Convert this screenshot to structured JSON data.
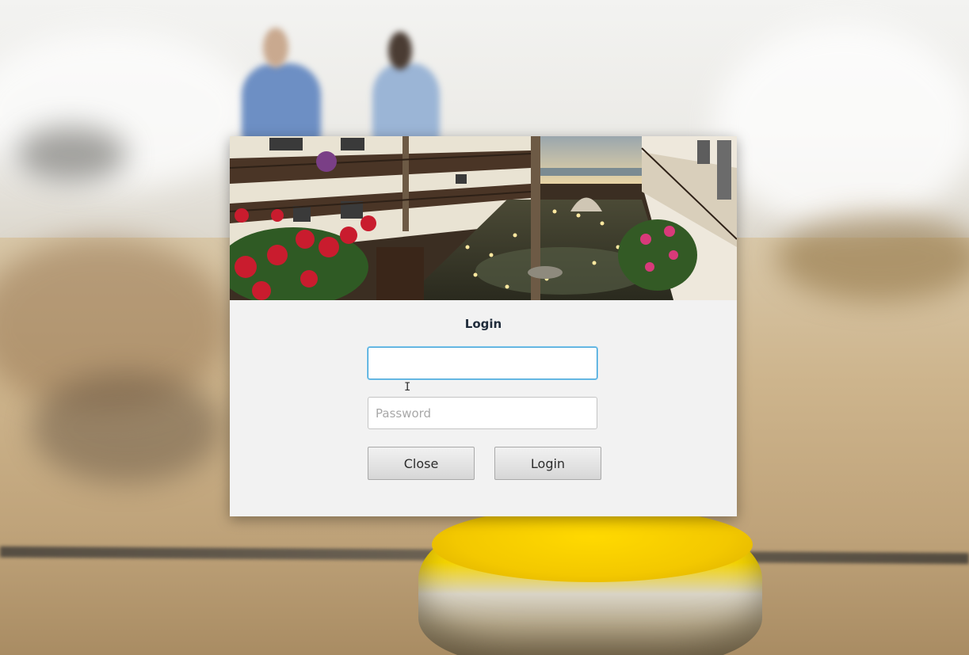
{
  "dialog": {
    "title": "Login",
    "username": {
      "value": "",
      "placeholder": ""
    },
    "password": {
      "value": "",
      "placeholder": "Password"
    },
    "buttons": {
      "close": "Close",
      "login": "Login"
    }
  },
  "icons": {
    "text_cursor": "text-cursor-icon"
  },
  "colors": {
    "title": "#1f2b3a",
    "focus_ring": "#3b9fd5",
    "dialog_bg": "#f2f2f2"
  }
}
